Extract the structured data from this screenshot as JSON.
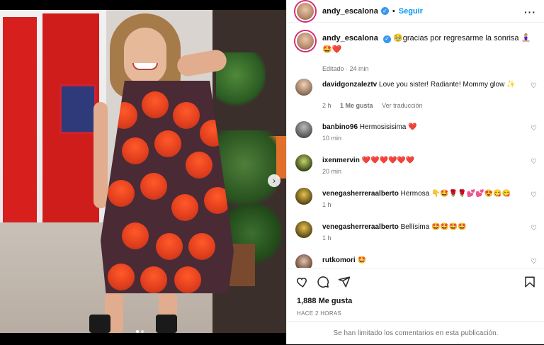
{
  "post": {
    "username": "andy_escalona",
    "follow_label": "Seguir",
    "caption_user": "andy_escalona",
    "caption_text": "🥹gracias por regresarme la sonrisa 🧘🏼‍♀️🤩❤️",
    "caption_meta": "Editado · 24 min",
    "likes": "1,888 Me gusta",
    "time": "HACE 2 HORAS",
    "limit_notice": "Se han limitado los comentarios en esta publicación."
  },
  "comments": [
    {
      "user": "davidgonzaleztv",
      "text": "Love you sister! Radiante! Mommy glow ✨",
      "time": "2 h",
      "likes": "1 Me gusta",
      "reply": "Ver traducción"
    },
    {
      "user": "banbino96",
      "text": "Hermosisisima ❤️",
      "time": "10 min",
      "likes": "",
      "reply": ""
    },
    {
      "user": "ixenmervin",
      "text": "❤️❤️❤️❤️❤️❤️",
      "time": "20 min",
      "likes": "",
      "reply": ""
    },
    {
      "user": "venegasherreraalberto",
      "text": "Hermosa 👇🤩🌹🌹💕💕😍😋😋",
      "time": "1 h",
      "likes": "",
      "reply": ""
    },
    {
      "user": "venegasherreraalberto",
      "text": "Bellísima 🤩🤩🤩🤩",
      "time": "1 h",
      "likes": "",
      "reply": ""
    },
    {
      "user": "rutkomori",
      "text": "🤩",
      "time": "",
      "likes": "",
      "reply": ""
    }
  ],
  "icons": {
    "more": "more-icon",
    "heart": "heart-icon",
    "comment": "comment-icon",
    "share": "share-icon",
    "save": "bookmark-icon",
    "next": "chevron-right-icon"
  },
  "colors": {
    "accent": "#0095f6",
    "verified": "#3897f0",
    "muted": "#737373"
  }
}
